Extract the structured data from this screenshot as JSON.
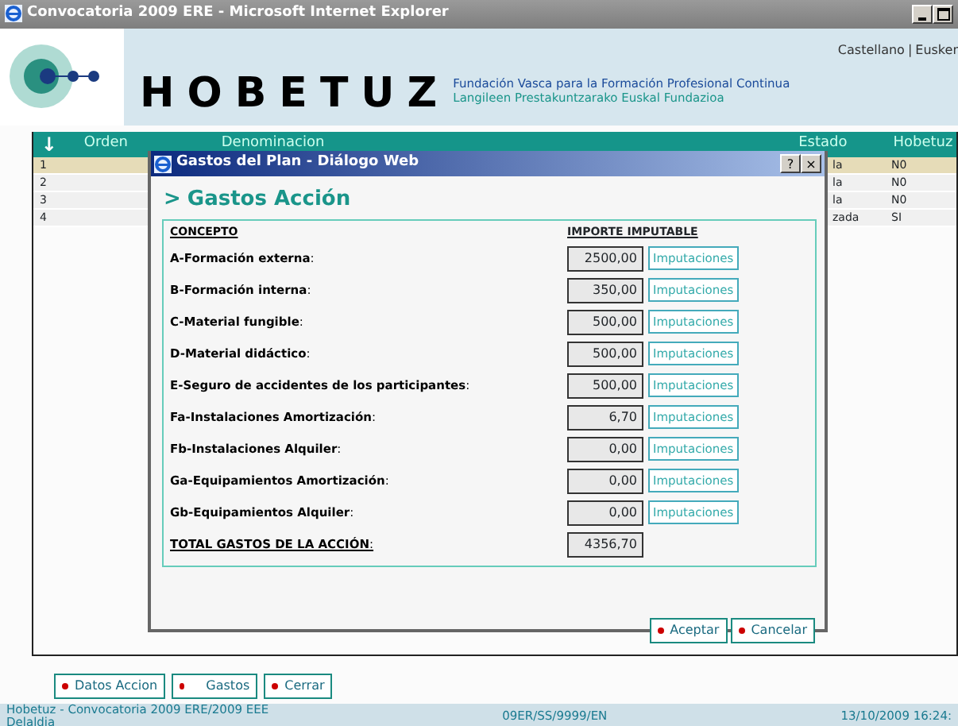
{
  "window": {
    "title": "Convocatoria 2009 ERE - Microsoft Internet Explorer"
  },
  "header": {
    "links": [
      "Castellano",
      "Eusker"
    ],
    "separator": "|",
    "brand": "HOBETUZ",
    "tagline": [
      "Fundación Vasca para la Formación Profesional Continua",
      "Langileen Prestakuntzarako Euskal Fundazioa"
    ]
  },
  "table": {
    "sort_icon": "↓",
    "columns": [
      "Orden",
      "Denominacion",
      "Estado",
      "Hobetuz"
    ],
    "rows": [
      {
        "orden": "1",
        "estado": "la",
        "hobetuz": "N0",
        "selected": true
      },
      {
        "orden": "2",
        "estado": "la",
        "hobetuz": "N0",
        "selected": false
      },
      {
        "orden": "3",
        "estado": "la",
        "hobetuz": "N0",
        "selected": false
      },
      {
        "orden": "4",
        "estado": "zada",
        "hobetuz": "SI",
        "selected": false
      }
    ]
  },
  "dialog": {
    "title": "Gastos del Plan - Diálogo Web",
    "help": "?",
    "close": "×",
    "marker": ">",
    "heading": "Gastos Acción",
    "columns": [
      "CONCEPTO",
      "IMPORTE IMPUTABLE"
    ],
    "items": [
      {
        "kind": "line",
        "label": "**A-Formación externa**:",
        "value": "2500,00",
        "button": "Imputaciones"
      },
      {
        "kind": "line",
        "label": "**B-Formación interna**:",
        "value": "350,00",
        "button": "Imputaciones"
      },
      {
        "kind": "line",
        "label": "**C-Material fungible**:",
        "value": "500,00",
        "button": "Imputaciones"
      },
      {
        "kind": "line",
        "label": "**D-Material didáctico**:",
        "value": "500,00",
        "button": "Imputaciones"
      },
      {
        "kind": "line",
        "label": "**E-Seguro de accidentes de los participantes**:",
        "value": "500,00",
        "button": "Imputaciones"
      },
      {
        "kind": "line",
        "label": "**Fa-Instalaciones Amortización**:",
        "value": "6,70",
        "button": "Imputaciones"
      },
      {
        "kind": "line",
        "label": "**Fb-Instalaciones Alquiler**:",
        "value": "0,00",
        "button": "Imputaciones"
      },
      {
        "kind": "line",
        "label": "**Ga-Equipamientos Amortización**:",
        "value": "0,00",
        "button": "Imputaciones"
      },
      {
        "kind": "line",
        "label": "**Gb-Equipamientos Alquiler**:",
        "value": "0,00",
        "button": "Imputaciones"
      },
      {
        "kind": "total",
        "label": "**TOTAL GASTOS DE LA ACCIÓN**:",
        "value": "4356,70"
      }
    ],
    "buttons": [
      "Aceptar",
      "Cancelar"
    ]
  },
  "footer_buttons": [
    "Datos Accion",
    "Gastos",
    "Cerrar"
  ],
  "status_bar": {
    "left": [
      "Hobetuz - Convocatoria 2009 ERE/2009 EEE",
      "Delaldia"
    ],
    "center": "09ER/SS/9999/EN",
    "right": "13/10/2009 16:24:"
  }
}
